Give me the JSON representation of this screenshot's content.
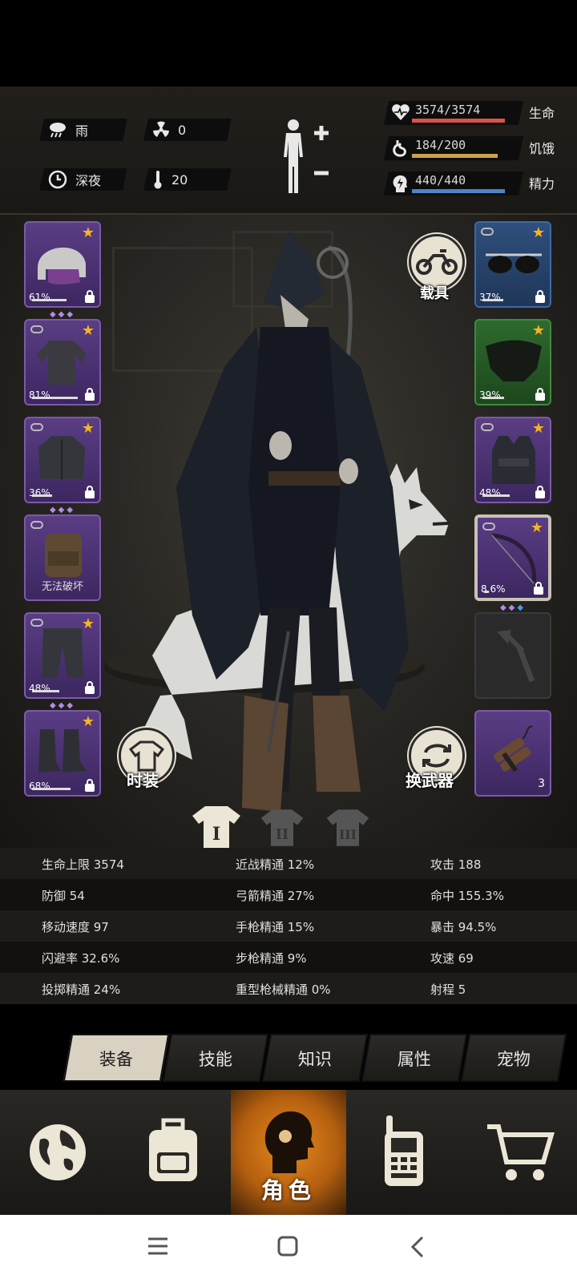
{
  "status": {
    "weather": "雨",
    "radiation": "0",
    "time_of_day": "深夜",
    "temperature": "20"
  },
  "vitals": [
    {
      "value": "3574/3574",
      "label": "生命",
      "fill": 1.0,
      "color": "#d9534a"
    },
    {
      "value": "184/200",
      "label": "饥饿",
      "fill": 0.92,
      "color": "#c8a24a"
    },
    {
      "value": "440/440",
      "label": "精力",
      "fill": 1.0,
      "color": "#4a86c8"
    }
  ],
  "left_slots": [
    {
      "name": "helmet",
      "pct": "61%",
      "star": true
    },
    {
      "name": "shirt",
      "pct": "81%",
      "star": true
    },
    {
      "name": "jacket",
      "pct": "36%",
      "star": true
    },
    {
      "name": "backpack",
      "note": "无法破坏"
    },
    {
      "name": "pants",
      "pct": "48%",
      "star": true
    },
    {
      "name": "boots",
      "pct": "68%",
      "star": true
    }
  ],
  "right_slots": [
    {
      "name": "glasses",
      "pct": "37%",
      "star": true
    },
    {
      "name": "mask",
      "pct": "39%",
      "star": true
    },
    {
      "name": "vest",
      "pct": "48%",
      "star": true
    },
    {
      "name": "bow",
      "pct": "8.6%",
      "star": true
    },
    {
      "name": "axe-empty"
    },
    {
      "name": "dynamite",
      "count": "3"
    }
  ],
  "buttons": {
    "vehicle": "载具",
    "fashion": "时装",
    "swap_weapon": "换武器"
  },
  "stats": [
    [
      "生命上限 3574",
      "近战精通 12%",
      "攻击 188"
    ],
    [
      "防御 54",
      "弓箭精通 27%",
      "命中 155.3%"
    ],
    [
      "移动速度 97",
      "手枪精通 15%",
      "暴击 94.5%"
    ],
    [
      "闪避率 32.6%",
      "步枪精通 9%",
      "攻速 69"
    ],
    [
      "投掷精通 24%",
      "重型枪械精通 0%",
      "射程 5"
    ]
  ],
  "subtabs": [
    "装备",
    "技能",
    "知识",
    "属性",
    "宠物"
  ],
  "bottom_nav": {
    "active_label": "角色"
  },
  "colors": {
    "accent_orange": "#e58a1e",
    "epic_purple": "#5a3d84",
    "star": "#f5b51f"
  }
}
